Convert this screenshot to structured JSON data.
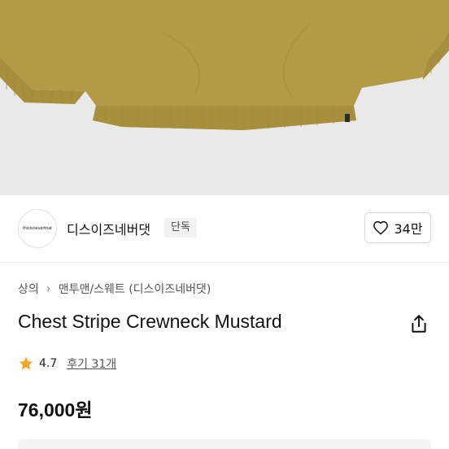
{
  "colors": {
    "garment": "#b39a47",
    "garment_shadow": "#9e8638",
    "hero_bg": "#e9e9e9",
    "star": "#f5a623"
  },
  "brand": {
    "logo_text": "thisisneverthat",
    "name": "디스이즈네버댓",
    "badge": "단독"
  },
  "like": {
    "icon": "heart-icon",
    "count": "34만"
  },
  "breadcrumb": {
    "category": "상의",
    "separator_icon": "chevron-right-icon",
    "subcategory": "맨투맨/스웨트 (디스이즈네버댓)"
  },
  "product": {
    "title": "Chest Stripe Crewneck Mustard",
    "share_icon": "share-icon",
    "rating_icon": "star-icon",
    "rating": "4.7",
    "reviews": "후기 31개",
    "price": "76,000원"
  }
}
